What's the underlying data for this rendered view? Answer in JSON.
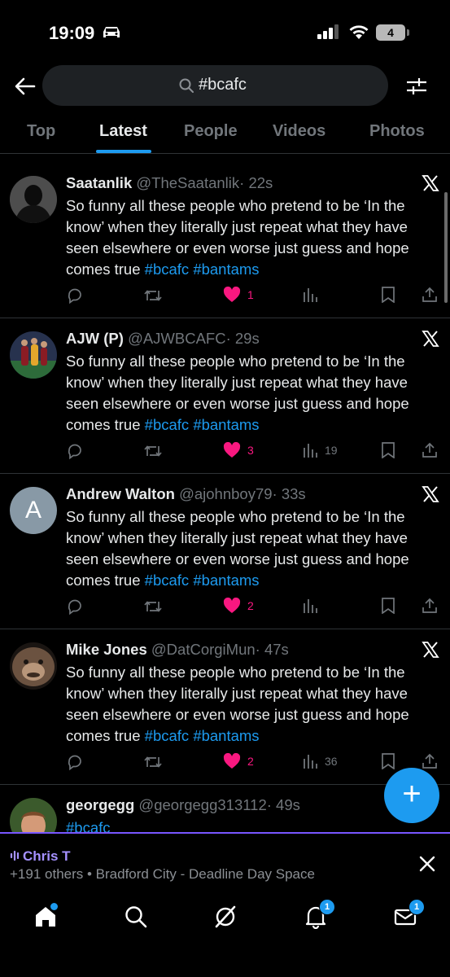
{
  "status_bar": {
    "time": "19:09",
    "battery": "4"
  },
  "search": {
    "query": "#bcafc"
  },
  "tabs": [
    {
      "label": "Top"
    },
    {
      "label": "Latest"
    },
    {
      "label": "People"
    },
    {
      "label": "Videos"
    },
    {
      "label": "Photos"
    }
  ],
  "tweets": [
    {
      "name": "Saatanlik",
      "handle": "@TheSaatanlik",
      "time": "· 22s",
      "text": "So funny all these people who pretend to be ‘In the know’ when they literally just repeat what they have seen elsewhere or even worse just guess and hope comes true",
      "tag1": "#bcafc",
      "tag2": "#bantams",
      "likes": "1",
      "views": ""
    },
    {
      "name": "AJW (P)",
      "handle": "@AJWBCAFC",
      "time": "· 29s",
      "text": "So funny all these people who pretend to be ‘In the know’ when they literally just repeat what they have seen elsewhere or even worse just guess and hope comes true",
      "tag1": "#bcafc",
      "tag2": "#bantams",
      "likes": "3",
      "views": "19"
    },
    {
      "name": "Andrew Walton",
      "handle": "@ajohnboy79",
      "time": "· 33s",
      "avatar_letter": "A",
      "text": "So funny all these people who pretend to be ‘In the know’ when they literally just repeat what they have seen elsewhere or even worse just guess and hope comes true",
      "tag1": "#bcafc",
      "tag2": "#bantams",
      "likes": "2",
      "views": ""
    },
    {
      "name": "Mike Jones",
      "handle": "@DatCorgiMun",
      "time": "· 47s",
      "text": "So funny all these people who pretend to be ‘In the know’ when they literally just repeat what they have seen elsewhere or even worse just guess and hope comes true",
      "tag1": "#bcafc",
      "tag2": "#bantams",
      "likes": "2",
      "views": "36"
    },
    {
      "name": "georgegg",
      "handle": "@georgegg313112",
      "time": "· 49s",
      "tag1": "#bcafc"
    }
  ],
  "space": {
    "host": "Chris T",
    "details": "+191 others • Bradford City - Deadline Day Space"
  },
  "nav": {
    "notifications_badge": "1",
    "messages_badge": "1"
  },
  "colors": {
    "accent": "#1d9bf0",
    "like": "#f91880",
    "space": "#7856ff"
  }
}
